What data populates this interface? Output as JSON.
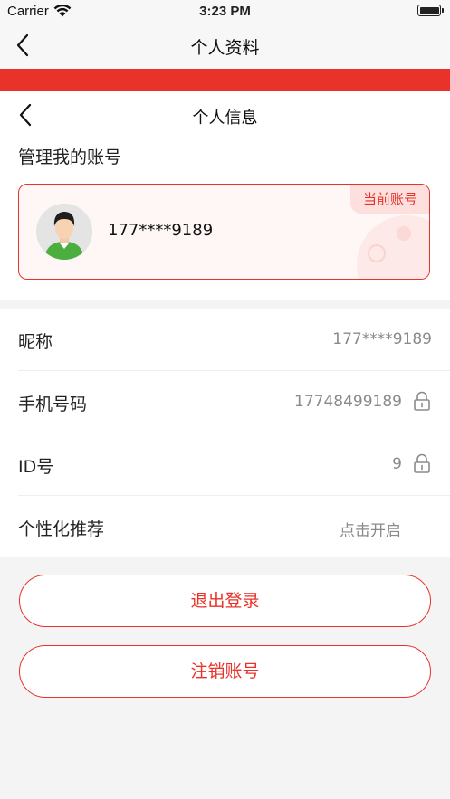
{
  "status_bar": {
    "carrier": "Carrier",
    "time": "3:23 PM"
  },
  "nav": {
    "title": "个人资料",
    "back_icon": "chevron-left-icon"
  },
  "sub_header": {
    "title": "个人信息",
    "back_icon": "chevron-left-icon"
  },
  "account_section": {
    "label": "管理我的账号",
    "card": {
      "badge": "当前账号",
      "account_number": "177****9189"
    }
  },
  "info_rows": [
    {
      "label": "昵称",
      "value": "177****9189",
      "locked": false
    },
    {
      "label": "手机号码",
      "value": "17748499189",
      "locked": true
    },
    {
      "label": "ID号",
      "value": "9",
      "locked": true
    },
    {
      "label": "个性化推荐",
      "value": "点击开启",
      "locked": false
    }
  ],
  "actions": {
    "logout_label": "退出登录",
    "deactivate_label": "注销账号"
  },
  "colors": {
    "accent": "#e8322a",
    "card_background": "#fff6f6",
    "badge_background": "#fde0de",
    "page_background": "#f4f4f4"
  }
}
